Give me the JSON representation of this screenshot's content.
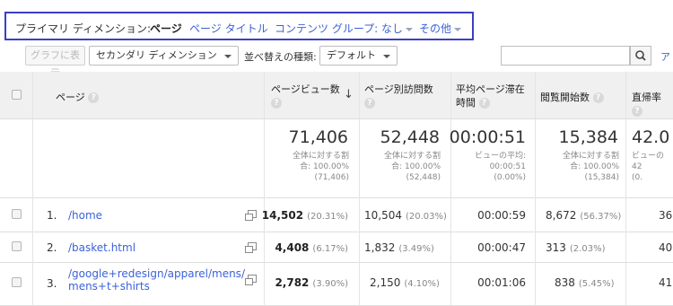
{
  "dimension_bar": {
    "label": "プライマリ ディメンション:",
    "active": "ページ",
    "options": [
      "ページ タイトル",
      "コンテンツ グループ: なし",
      "その他"
    ]
  },
  "toolbar": {
    "graph_button": "グラフに表示",
    "secondary_dimension": "セカンダリ ディメンション",
    "sort_label": "並べ替えの種類:",
    "sort_value": "デフォルト",
    "search_placeholder": "",
    "advanced_link": "ア"
  },
  "table": {
    "headers": {
      "page": "ページ",
      "pageviews": "ページビュー数",
      "unique_pageviews": "ページ別訪問数",
      "avg_time_1": "平均ページ滞在",
      "avg_time_2": "時間",
      "entrances": "閲覧開始数",
      "bounce": "直帰率"
    },
    "totals": {
      "pageviews": {
        "value": "71,406",
        "sub": "全体に対する割\n合: 100.00%\n(71,406)"
      },
      "unique_pageviews": {
        "value": "52,448",
        "sub": "全体に対する割\n合: 100.00%\n(52,448)"
      },
      "avg_time": {
        "value": "00:00:51",
        "sub": "ビューの平均:\n00:00:51\n(0.00%)"
      },
      "entrances": {
        "value": "15,384",
        "sub": "全体に対する割\n合: 100.00%\n(15,384)"
      },
      "bounce": {
        "value": "42.0",
        "sub": "ビューの\n42\n(0."
      }
    },
    "rows": [
      {
        "num": "1.",
        "page": "/home",
        "pageviews": "14,502",
        "pageviews_pct": "(20.31%)",
        "unique": "10,504",
        "unique_pct": "(20.03%)",
        "avg_time": "00:00:59",
        "entrances": "8,672",
        "entrances_pct": "(56.37%)",
        "bounce": "36"
      },
      {
        "num": "2.",
        "page": "/basket.html",
        "pageviews": "4,408",
        "pageviews_pct": "(6.17%)",
        "unique": "1,832",
        "unique_pct": "(3.49%)",
        "avg_time": "00:00:47",
        "entrances": "313",
        "entrances_pct": "(2.03%)",
        "bounce": "40"
      },
      {
        "num": "3.",
        "page_line1": "/google+redesign/apparel/mens/",
        "page_line2": "mens+t+shirts",
        "pageviews": "2,782",
        "pageviews_pct": "(3.90%)",
        "unique": "2,150",
        "unique_pct": "(4.10%)",
        "avg_time": "00:01:06",
        "entrances": "838",
        "entrances_pct": "(5.45%)",
        "bounce": "41"
      }
    ]
  },
  "colors": {
    "accent_border": "#3b3fc4",
    "link": "#3b62d8",
    "header_bg": "#f0f0f0"
  }
}
